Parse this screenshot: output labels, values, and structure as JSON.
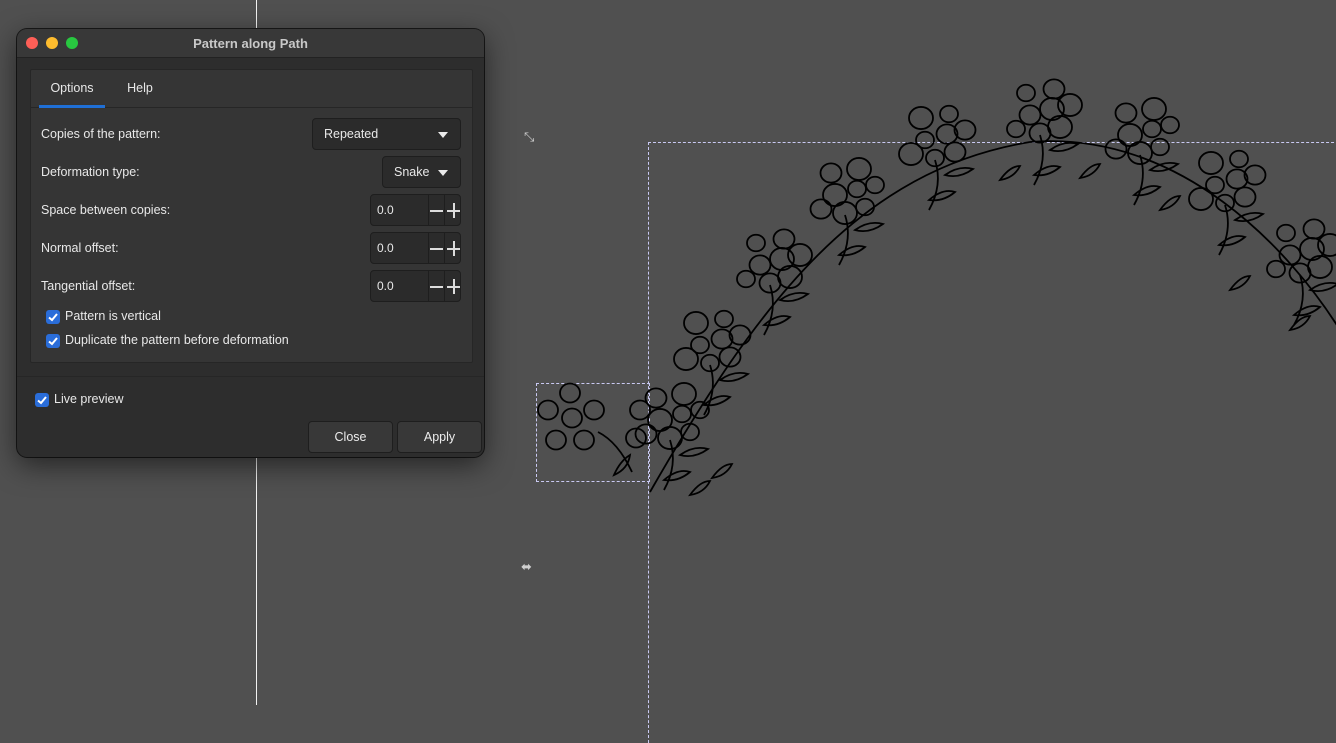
{
  "dialog": {
    "title": "Pattern along Path",
    "tabs": [
      {
        "label": "Options",
        "active": true
      },
      {
        "label": "Help",
        "active": false
      }
    ],
    "fields": {
      "copies": {
        "label": "Copies of the pattern:",
        "value": "Repeated"
      },
      "deformation": {
        "label": "Deformation type:",
        "value": "Snake"
      },
      "space_between": {
        "label": "Space between copies:",
        "value": "0.0"
      },
      "normal_offset": {
        "label": "Normal offset:",
        "value": "0.0"
      },
      "tangential_offset": {
        "label": "Tangential offset:",
        "value": "0.0"
      }
    },
    "checkboxes": {
      "pattern_vertical": {
        "label": "Pattern is vertical",
        "checked": true
      },
      "duplicate_pattern": {
        "label": "Duplicate the pattern before deformation",
        "checked": true
      },
      "live_preview": {
        "label": "Live preview",
        "checked": true
      }
    },
    "buttons": {
      "close": "Close",
      "apply": "Apply"
    }
  },
  "canvas": {
    "background": "#505050",
    "selection_color": "#c9c9f2",
    "artwork": "floral-vine-arch-pattern"
  },
  "colors": {
    "accent": "#2a6dd9",
    "tab_underline": "#1f6fd6"
  }
}
